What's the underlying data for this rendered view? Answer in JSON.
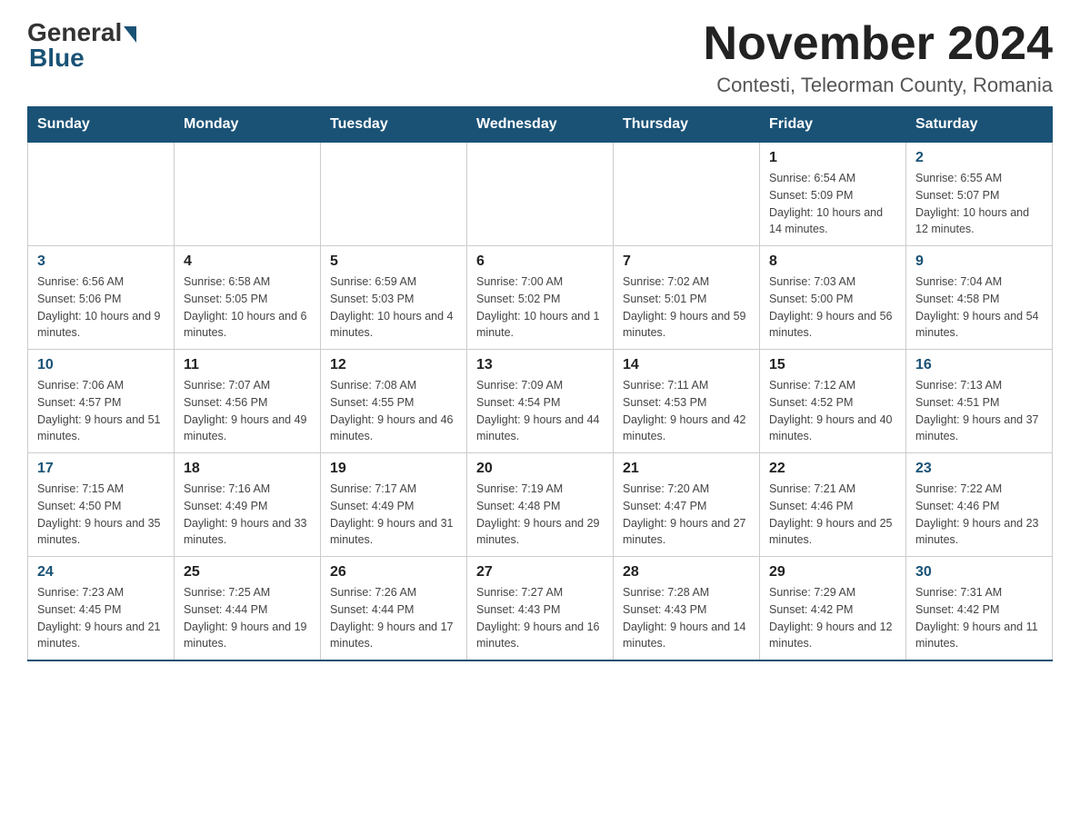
{
  "logo": {
    "text_general": "General",
    "text_blue": "Blue"
  },
  "title": "November 2024",
  "subtitle": "Contesti, Teleorman County, Romania",
  "days_of_week": [
    "Sunday",
    "Monday",
    "Tuesday",
    "Wednesday",
    "Thursday",
    "Friday",
    "Saturday"
  ],
  "weeks": [
    [
      {
        "day": "",
        "sunrise": "",
        "sunset": "",
        "daylight": ""
      },
      {
        "day": "",
        "sunrise": "",
        "sunset": "",
        "daylight": ""
      },
      {
        "day": "",
        "sunrise": "",
        "sunset": "",
        "daylight": ""
      },
      {
        "day": "",
        "sunrise": "",
        "sunset": "",
        "daylight": ""
      },
      {
        "day": "",
        "sunrise": "",
        "sunset": "",
        "daylight": ""
      },
      {
        "day": "1",
        "sunrise": "Sunrise: 6:54 AM",
        "sunset": "Sunset: 5:09 PM",
        "daylight": "Daylight: 10 hours and 14 minutes."
      },
      {
        "day": "2",
        "sunrise": "Sunrise: 6:55 AM",
        "sunset": "Sunset: 5:07 PM",
        "daylight": "Daylight: 10 hours and 12 minutes."
      }
    ],
    [
      {
        "day": "3",
        "sunrise": "Sunrise: 6:56 AM",
        "sunset": "Sunset: 5:06 PM",
        "daylight": "Daylight: 10 hours and 9 minutes."
      },
      {
        "day": "4",
        "sunrise": "Sunrise: 6:58 AM",
        "sunset": "Sunset: 5:05 PM",
        "daylight": "Daylight: 10 hours and 6 minutes."
      },
      {
        "day": "5",
        "sunrise": "Sunrise: 6:59 AM",
        "sunset": "Sunset: 5:03 PM",
        "daylight": "Daylight: 10 hours and 4 minutes."
      },
      {
        "day": "6",
        "sunrise": "Sunrise: 7:00 AM",
        "sunset": "Sunset: 5:02 PM",
        "daylight": "Daylight: 10 hours and 1 minute."
      },
      {
        "day": "7",
        "sunrise": "Sunrise: 7:02 AM",
        "sunset": "Sunset: 5:01 PM",
        "daylight": "Daylight: 9 hours and 59 minutes."
      },
      {
        "day": "8",
        "sunrise": "Sunrise: 7:03 AM",
        "sunset": "Sunset: 5:00 PM",
        "daylight": "Daylight: 9 hours and 56 minutes."
      },
      {
        "day": "9",
        "sunrise": "Sunrise: 7:04 AM",
        "sunset": "Sunset: 4:58 PM",
        "daylight": "Daylight: 9 hours and 54 minutes."
      }
    ],
    [
      {
        "day": "10",
        "sunrise": "Sunrise: 7:06 AM",
        "sunset": "Sunset: 4:57 PM",
        "daylight": "Daylight: 9 hours and 51 minutes."
      },
      {
        "day": "11",
        "sunrise": "Sunrise: 7:07 AM",
        "sunset": "Sunset: 4:56 PM",
        "daylight": "Daylight: 9 hours and 49 minutes."
      },
      {
        "day": "12",
        "sunrise": "Sunrise: 7:08 AM",
        "sunset": "Sunset: 4:55 PM",
        "daylight": "Daylight: 9 hours and 46 minutes."
      },
      {
        "day": "13",
        "sunrise": "Sunrise: 7:09 AM",
        "sunset": "Sunset: 4:54 PM",
        "daylight": "Daylight: 9 hours and 44 minutes."
      },
      {
        "day": "14",
        "sunrise": "Sunrise: 7:11 AM",
        "sunset": "Sunset: 4:53 PM",
        "daylight": "Daylight: 9 hours and 42 minutes."
      },
      {
        "day": "15",
        "sunrise": "Sunrise: 7:12 AM",
        "sunset": "Sunset: 4:52 PM",
        "daylight": "Daylight: 9 hours and 40 minutes."
      },
      {
        "day": "16",
        "sunrise": "Sunrise: 7:13 AM",
        "sunset": "Sunset: 4:51 PM",
        "daylight": "Daylight: 9 hours and 37 minutes."
      }
    ],
    [
      {
        "day": "17",
        "sunrise": "Sunrise: 7:15 AM",
        "sunset": "Sunset: 4:50 PM",
        "daylight": "Daylight: 9 hours and 35 minutes."
      },
      {
        "day": "18",
        "sunrise": "Sunrise: 7:16 AM",
        "sunset": "Sunset: 4:49 PM",
        "daylight": "Daylight: 9 hours and 33 minutes."
      },
      {
        "day": "19",
        "sunrise": "Sunrise: 7:17 AM",
        "sunset": "Sunset: 4:49 PM",
        "daylight": "Daylight: 9 hours and 31 minutes."
      },
      {
        "day": "20",
        "sunrise": "Sunrise: 7:19 AM",
        "sunset": "Sunset: 4:48 PM",
        "daylight": "Daylight: 9 hours and 29 minutes."
      },
      {
        "day": "21",
        "sunrise": "Sunrise: 7:20 AM",
        "sunset": "Sunset: 4:47 PM",
        "daylight": "Daylight: 9 hours and 27 minutes."
      },
      {
        "day": "22",
        "sunrise": "Sunrise: 7:21 AM",
        "sunset": "Sunset: 4:46 PM",
        "daylight": "Daylight: 9 hours and 25 minutes."
      },
      {
        "day": "23",
        "sunrise": "Sunrise: 7:22 AM",
        "sunset": "Sunset: 4:46 PM",
        "daylight": "Daylight: 9 hours and 23 minutes."
      }
    ],
    [
      {
        "day": "24",
        "sunrise": "Sunrise: 7:23 AM",
        "sunset": "Sunset: 4:45 PM",
        "daylight": "Daylight: 9 hours and 21 minutes."
      },
      {
        "day": "25",
        "sunrise": "Sunrise: 7:25 AM",
        "sunset": "Sunset: 4:44 PM",
        "daylight": "Daylight: 9 hours and 19 minutes."
      },
      {
        "day": "26",
        "sunrise": "Sunrise: 7:26 AM",
        "sunset": "Sunset: 4:44 PM",
        "daylight": "Daylight: 9 hours and 17 minutes."
      },
      {
        "day": "27",
        "sunrise": "Sunrise: 7:27 AM",
        "sunset": "Sunset: 4:43 PM",
        "daylight": "Daylight: 9 hours and 16 minutes."
      },
      {
        "day": "28",
        "sunrise": "Sunrise: 7:28 AM",
        "sunset": "Sunset: 4:43 PM",
        "daylight": "Daylight: 9 hours and 14 minutes."
      },
      {
        "day": "29",
        "sunrise": "Sunrise: 7:29 AM",
        "sunset": "Sunset: 4:42 PM",
        "daylight": "Daylight: 9 hours and 12 minutes."
      },
      {
        "day": "30",
        "sunrise": "Sunrise: 7:31 AM",
        "sunset": "Sunset: 4:42 PM",
        "daylight": "Daylight: 9 hours and 11 minutes."
      }
    ]
  ]
}
